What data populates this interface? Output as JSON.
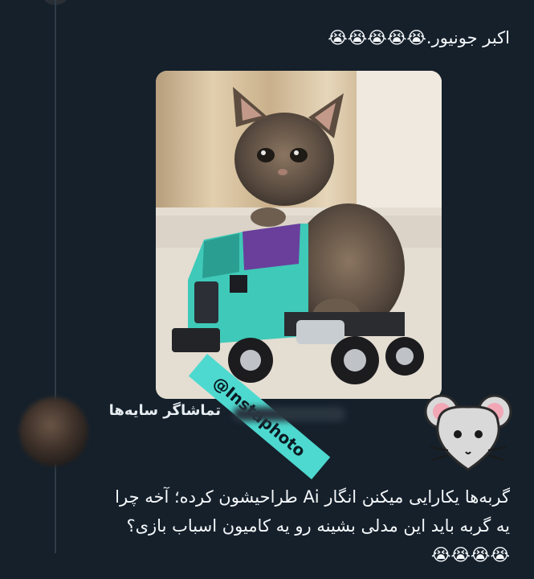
{
  "tweet1": {
    "text": "اکبر جونیور.😭😭😭😭😭"
  },
  "photo": {
    "watermark": "@Instaphoto"
  },
  "caption": {
    "text": "تماشاگر سایه‌ها"
  },
  "tweet2": {
    "line1": "گربه‌ها یکارایی میکنن انگار Ai طراحیشون کرده؛ آخه چرا",
    "line2": "یه گربه باید این مدلی بشینه رو یه کامیون اسباب بازی؟",
    "emojis": "😭😭😭😭"
  },
  "icons": {
    "mouse_sticker": "mouse-face-icon"
  }
}
